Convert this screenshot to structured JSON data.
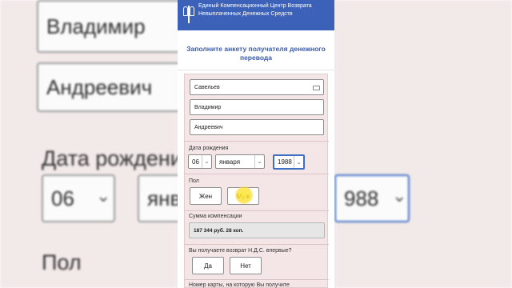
{
  "header": {
    "org_name": "Единый Компенсационный Центр Возврата Невыплаченных Денежных Средств"
  },
  "form": {
    "title": "Заполните анкету получателя денежного перевода",
    "last_name": "Савельев",
    "first_name": "Владимир",
    "patronymic": "Андреевич",
    "birth_label": "Дата рождения",
    "birth_day": "06",
    "birth_month": "января",
    "birth_year": "1988",
    "gender_label": "Пол",
    "gender_female": "Жен",
    "gender_male": "Муж",
    "amount_label": "Сумма компенсации",
    "amount_value": "187 344 руб. 28 коп.",
    "vat_question": "Вы получаете возврат Н.Д.С. впервые?",
    "yes_label": "Да",
    "no_label": "Нет",
    "card_question_partial": "Номер карты, на которую Вы получите"
  },
  "background": {
    "first_name": "Владимир",
    "patronymic": "Андреевич",
    "birth_label": "Дата рождени",
    "day": "06",
    "month_partial": "янв",
    "year_partial": "988",
    "gender_label": "Пол"
  },
  "colors": {
    "header_blue": "#3b62b8",
    "title_blue": "#3b5aa8",
    "form_pink": "#f4e6e6",
    "focus_blue": "#3f6fc3"
  }
}
